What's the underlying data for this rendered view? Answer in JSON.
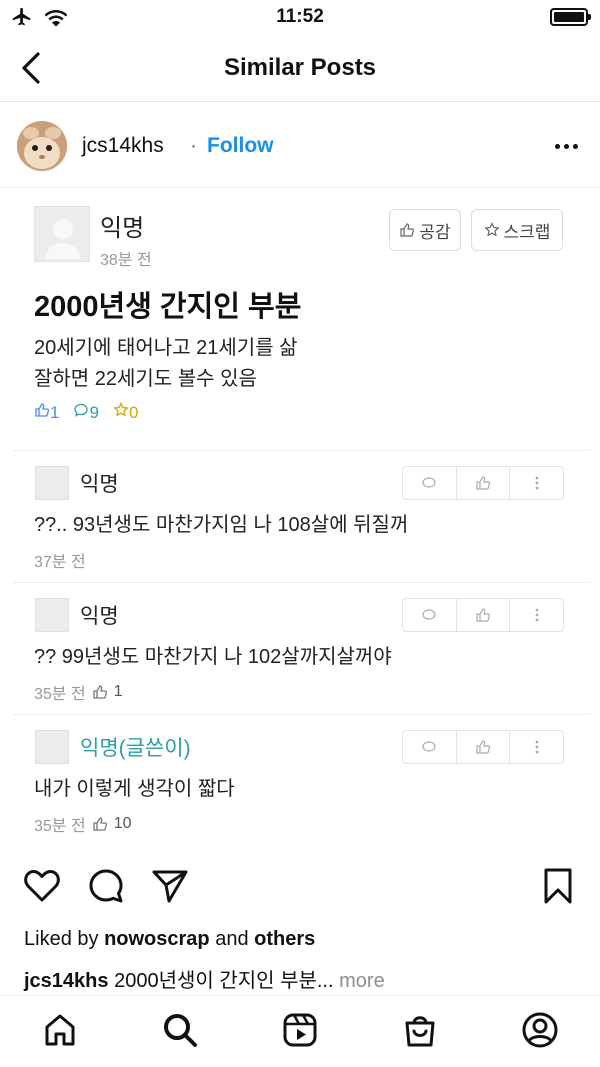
{
  "status_bar": {
    "time": "11:52"
  },
  "nav": {
    "title": "Similar Posts"
  },
  "post": {
    "username": "jcs14khs",
    "separator": "·",
    "follow_label": "Follow"
  },
  "community_post": {
    "author": "익명",
    "time": "38분 전",
    "like_button_label": "공감",
    "scrap_button_label": "스크랩",
    "title": "2000년생 간지인 부분",
    "body_line1": "20세기에 태어나고 21세기를 삶",
    "body_line2": "잘하면 22세기도 볼수 있음",
    "likes": "1",
    "comments": "9",
    "scraps": "0"
  },
  "comments": [
    {
      "name": "익명",
      "text": "??.. 93년생도 마찬가지임 나 108살에 뒤질꺼",
      "time": "37분 전",
      "likes": ""
    },
    {
      "name": "익명",
      "text": "?? 99년생도 마찬가지 나 102살까지살꺼야",
      "time": "35분 전",
      "likes": "1"
    },
    {
      "name": "익명(글쓴이)",
      "text": "내가 이렇게 생각이 짧다",
      "time": "35분 전",
      "likes": "10"
    }
  ],
  "likes_line": {
    "prefix": "Liked by ",
    "user": "nowoscrap",
    "middle": " and ",
    "others": "others"
  },
  "caption": {
    "username": "jcs14khs",
    "text": " 2000년생이 간지인 부분...",
    "more": " more"
  },
  "icons": {
    "airplane": "airplane-icon",
    "wifi": "wifi-icon",
    "battery": "battery-icon",
    "back": "back-chevron-icon",
    "heart": "heart-icon",
    "comment": "comment-icon",
    "share": "send-icon",
    "save": "bookmark-icon",
    "home": "home-icon",
    "search": "search-icon",
    "reels": "reels-icon",
    "shop": "shop-icon",
    "profile": "profile-icon"
  }
}
